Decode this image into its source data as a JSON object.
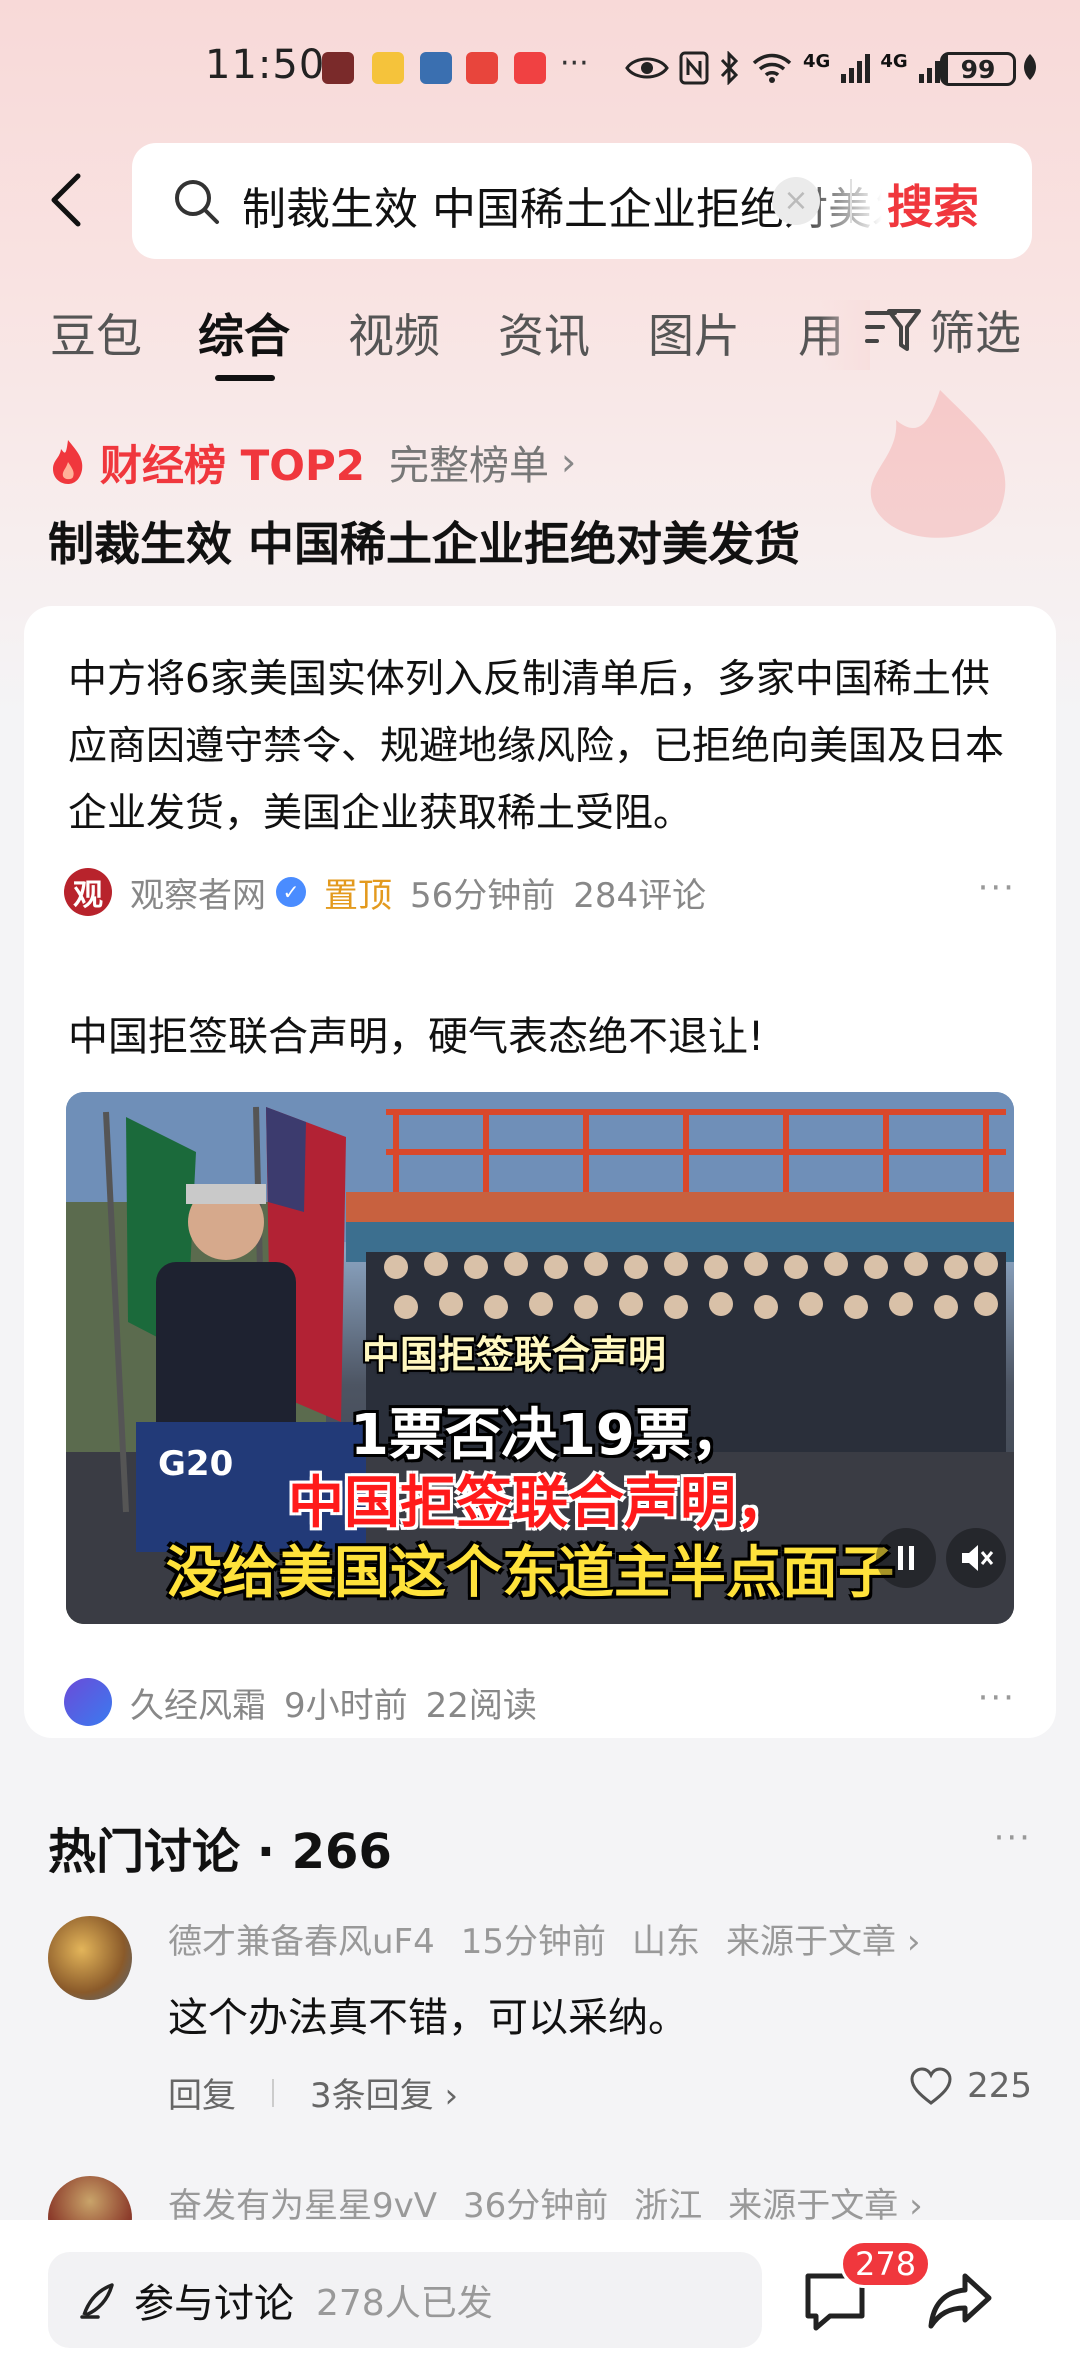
{
  "status_bar": {
    "time": "11:50",
    "more": "···",
    "battery": "99",
    "net1": "4G",
    "net2": "4G"
  },
  "search": {
    "query": "制裁生效 中国稀土企业拒绝对美发货",
    "clear": "×",
    "submit_label": "搜索"
  },
  "tabs": [
    {
      "label": "豆包"
    },
    {
      "label": "综合"
    },
    {
      "label": "视频"
    },
    {
      "label": "资讯"
    },
    {
      "label": "图片"
    },
    {
      "label": "用"
    }
  ],
  "filter_label": "筛选",
  "hot": {
    "label": "财经榜 TOP2",
    "full_list": "完整榜单",
    "chevron": "›",
    "topic": "制裁生效 中国稀土企业拒绝对美发货"
  },
  "article": {
    "text": "中方将6家美国实体列入反制清单后，多家中国稀土供应商因遵守禁令、规避地缘风险，已拒绝向美国及日本企业发货，美国企业获取稀土受阻。",
    "source_logo": "观",
    "source": "观察者网",
    "verified": "✓",
    "pinned": "置顶",
    "time": "56分钟前",
    "comments": "284评论",
    "more": "···"
  },
  "video_post": {
    "title": "中国拒签联合声明，硬气表态绝不退让!",
    "caption1": "中国拒签联合声明",
    "caption2": "1票否决19票，",
    "caption3": "中国拒签联合声明，",
    "caption4": "没给美国这个东道主半点面子",
    "podium": "G20",
    "author": "久经风霜",
    "time": "9小时前",
    "reads": "22阅读",
    "more": "···"
  },
  "discussion": {
    "title": "热门讨论 · 266",
    "more": "···",
    "comments": [
      {
        "user": "德才兼备春风uF4",
        "time": "15分钟前",
        "region": "山东",
        "source": "来源于文章 ›",
        "text": "这个办法真不错，可以采纳。",
        "reply": "回复",
        "replies": "3条回复 ›",
        "likes": "225"
      },
      {
        "user": "奋发有为星星9vV",
        "time": "36分钟前",
        "region": "浙江",
        "source": "来源于文章 ›"
      }
    ]
  },
  "bottom": {
    "join_label": "参与讨论",
    "join_count": "278人已发",
    "badge": "278"
  },
  "colors": {
    "accent": "#f0373d",
    "pinned": "#e39a1e",
    "verified": "#4a8cff"
  }
}
